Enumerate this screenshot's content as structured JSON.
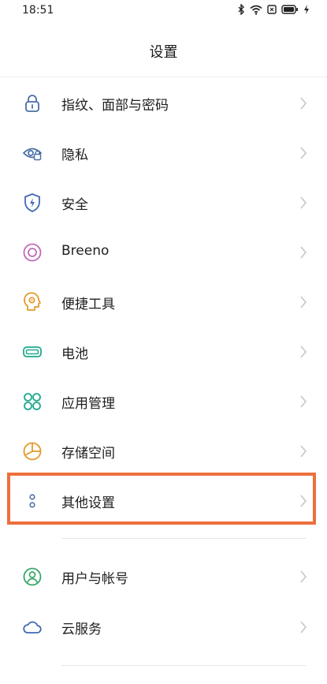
{
  "status_bar": {
    "time": "18:51",
    "icons": [
      "bluetooth-icon",
      "wifi-icon",
      "sim-icon",
      "battery-icon",
      "charging-icon"
    ]
  },
  "header": {
    "title": "设置"
  },
  "settings": {
    "items": [
      {
        "label": "指纹、面部与密码",
        "icon": "lock-icon",
        "color": "#4a6fa5"
      },
      {
        "label": "隐私",
        "icon": "privacy-eye-icon",
        "color": "#4a6fa5"
      },
      {
        "label": "安全",
        "icon": "shield-icon",
        "color": "#3f68b8"
      },
      {
        "label": "Breeno",
        "icon": "breeno-icon",
        "color": "#c06ab8"
      },
      {
        "label": "便捷工具",
        "icon": "tools-icon",
        "color": "#e39a2b"
      },
      {
        "label": "电池",
        "icon": "battery-icon",
        "color": "#1fa98c"
      },
      {
        "label": "应用管理",
        "icon": "apps-icon",
        "color": "#1fa98c"
      },
      {
        "label": "存储空间",
        "icon": "storage-icon",
        "color": "#e39a2b"
      },
      {
        "label": "其他设置",
        "icon": "more-dots-icon",
        "color": "#4a6fa5"
      },
      {
        "label": "用户与帐号",
        "icon": "user-icon",
        "color": "#36a86b"
      },
      {
        "label": "云服务",
        "icon": "cloud-icon",
        "color": "#3f68b8"
      }
    ]
  },
  "highlight": {
    "target": "其他设置",
    "color": "#ee6f3d"
  }
}
